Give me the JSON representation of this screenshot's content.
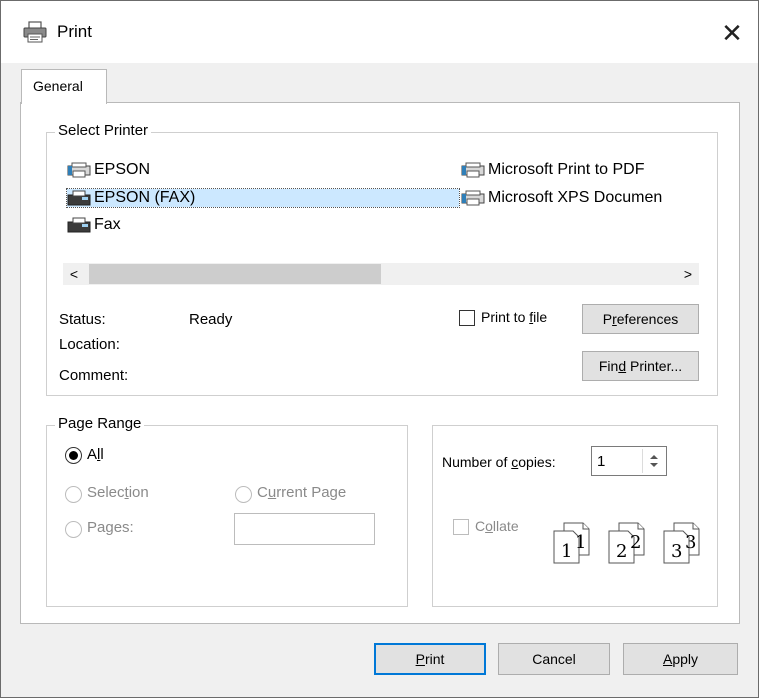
{
  "title": "Print",
  "tab": "General",
  "select_printer": {
    "label": "Select Printer",
    "printers_left": [
      "EPSON",
      "EPSON (FAX)",
      "Fax"
    ],
    "printers_right": [
      "Microsoft Print to PDF",
      "Microsoft XPS Documen"
    ],
    "status_label": "Status:",
    "status_value": "Ready",
    "location_label": "Location:",
    "comment_label": "Comment:",
    "print_to_file": {
      "pre": "Print to ",
      "key": "f",
      "post": "ile"
    },
    "preferences": {
      "pre": "P",
      "key": "r",
      "post": "eferences"
    },
    "find_printer": {
      "pre": "Fin",
      "key": "d",
      "post": " Printer..."
    }
  },
  "page_range": {
    "label": "Page Range",
    "all": {
      "pre": "A",
      "key": "l",
      "post": "l"
    },
    "selection": {
      "pre": "Selec",
      "key": "t",
      "post": "ion"
    },
    "current_page": {
      "pre": "C",
      "key": "u",
      "post": "rrent Page"
    },
    "pages": {
      "pre": "Pa",
      "key": "g",
      "post": "es:"
    }
  },
  "copies": {
    "label": {
      "pre": "Number of ",
      "key": "c",
      "post": "opies:"
    },
    "value": "1",
    "collate": {
      "pre": "C",
      "key": "o",
      "post": "llate"
    },
    "page_numbers": [
      "1",
      "1",
      "2",
      "2",
      "3",
      "3"
    ]
  },
  "buttons": {
    "print": {
      "pre": "",
      "key": "P",
      "post": "rint"
    },
    "cancel": "Cancel",
    "apply": {
      "pre": "",
      "key": "A",
      "post": "pply"
    }
  }
}
